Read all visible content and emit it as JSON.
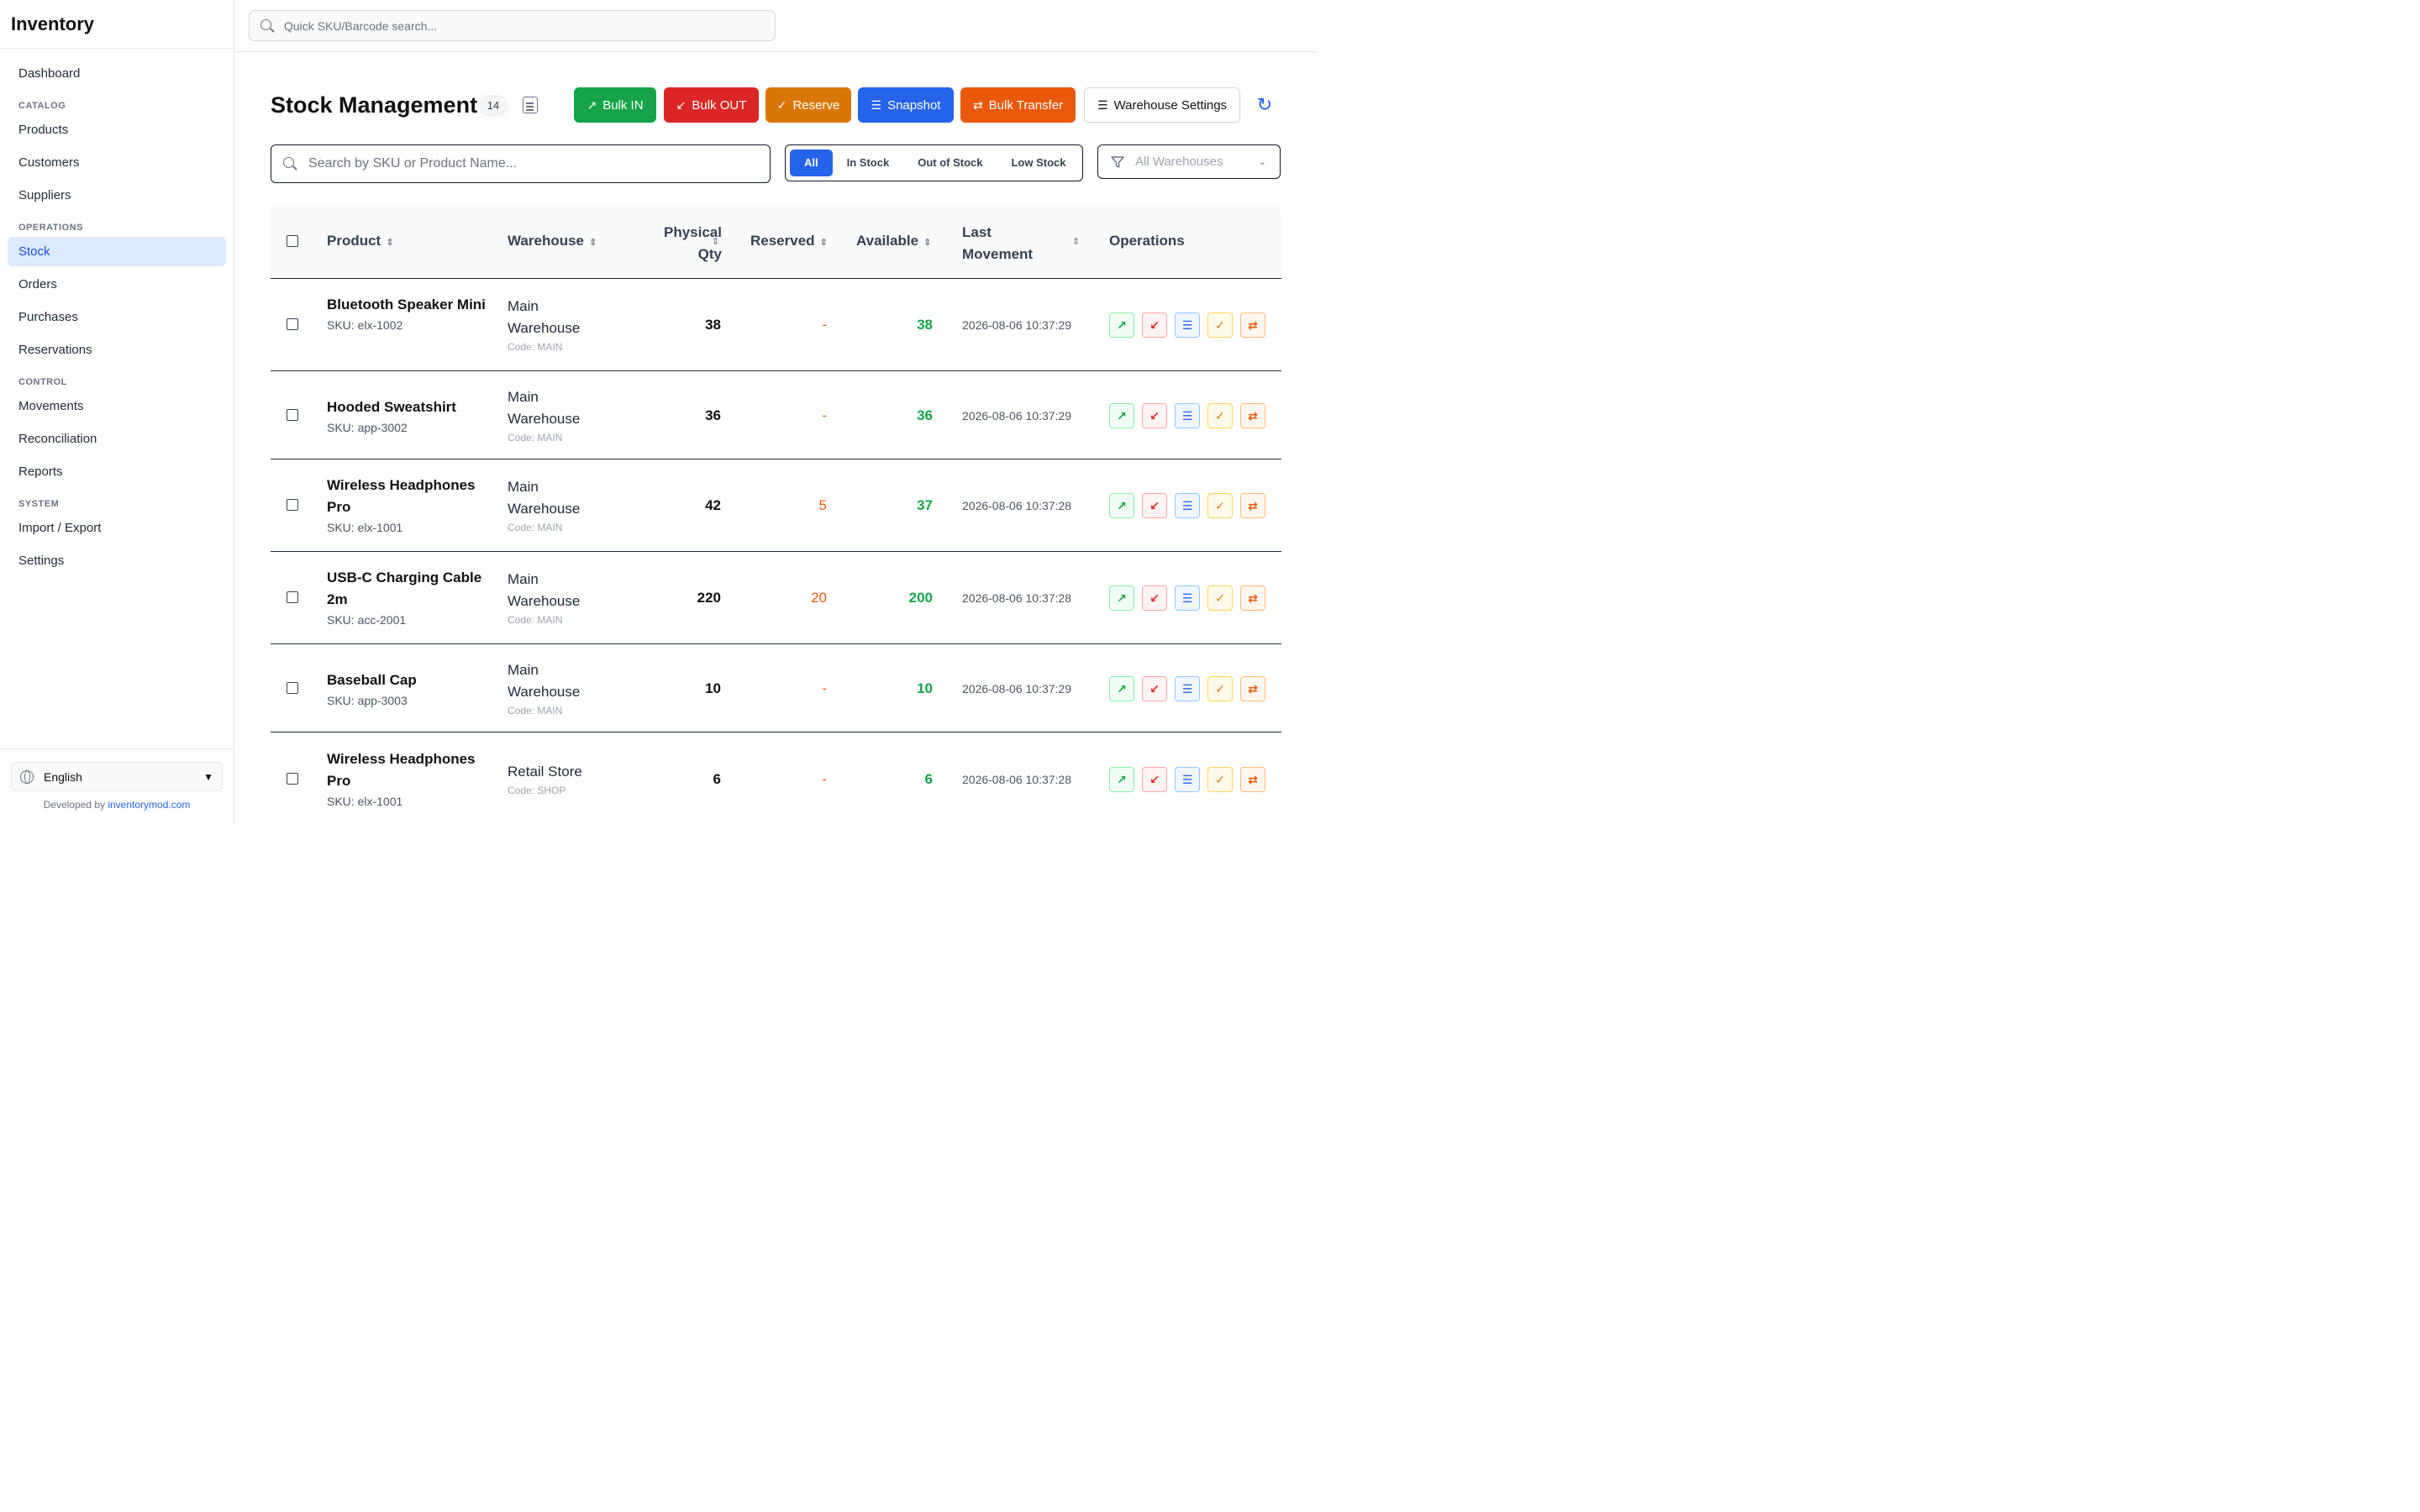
{
  "sidebar": {
    "brand": "Inventory",
    "items_top": [
      {
        "label": "Dashboard"
      }
    ],
    "catalog": {
      "title": "CATALOG",
      "items": [
        {
          "label": "Products"
        },
        {
          "label": "Customers"
        },
        {
          "label": "Suppliers"
        }
      ]
    },
    "operations": {
      "title": "OPERATIONS",
      "items": [
        {
          "label": "Stock",
          "active": true
        },
        {
          "label": "Orders"
        },
        {
          "label": "Purchases"
        },
        {
          "label": "Reservations"
        }
      ]
    },
    "control": {
      "title": "CONTROL",
      "items": [
        {
          "label": "Movements"
        },
        {
          "label": "Reconciliation"
        },
        {
          "label": "Reports"
        }
      ]
    },
    "system": {
      "title": "SYSTEM",
      "items": [
        {
          "label": "Import / Export"
        },
        {
          "label": "Settings"
        }
      ]
    },
    "language": "English",
    "dev_prefix": "Developed by",
    "dev_link": "inventorymod.com"
  },
  "topbar": {
    "quick_search_placeholder": "Quick SKU/Barcode search..."
  },
  "header": {
    "title": "Stock Management",
    "count": "14",
    "buttons": {
      "bulk_in": "Bulk IN",
      "bulk_out": "Bulk OUT",
      "reserve": "Reserve",
      "snapshot": "Snapshot",
      "bulk_transfer": "Bulk Transfer",
      "warehouse_settings": "Warehouse Settings"
    }
  },
  "filters": {
    "search_placeholder": "Search by SKU or Product Name...",
    "status_tabs": [
      "All",
      "In Stock",
      "Out of Stock",
      "Low Stock"
    ],
    "active_tab": "All",
    "warehouse_placeholder": "All Warehouses"
  },
  "table": {
    "columns": {
      "product": "Product",
      "warehouse": "Warehouse",
      "physical_qty_1": "Physical",
      "physical_qty_2": "Qty",
      "reserved": "Reserved",
      "available": "Available",
      "last_movement_1": "Last",
      "last_movement_2": "Movement",
      "operations": "Operations"
    },
    "rows": [
      {
        "name": "Bluetooth Speaker Mini",
        "sku": "SKU: elx-1002",
        "warehouse": "Main Warehouse",
        "code": "Code: MAIN",
        "qty": "38",
        "reserved": "-",
        "available": "38",
        "last": "2026-08-06 10:37:29"
      },
      {
        "name": "Hooded Sweatshirt",
        "sku": "SKU: app-3002",
        "warehouse": "Main Warehouse",
        "code": "Code: MAIN",
        "qty": "36",
        "reserved": "-",
        "available": "36",
        "last": "2026-08-06 10:37:29"
      },
      {
        "name": "Wireless Headphones Pro",
        "sku": "SKU: elx-1001",
        "warehouse": "Main Warehouse",
        "code": "Code: MAIN",
        "qty": "42",
        "reserved": "5",
        "available": "37",
        "last": "2026-08-06 10:37:28"
      },
      {
        "name": "USB-C Charging Cable 2m",
        "sku": "SKU: acc-2001",
        "warehouse": "Main Warehouse",
        "code": "Code: MAIN",
        "qty": "220",
        "reserved": "20",
        "available": "200",
        "last": "2026-08-06 10:37:28"
      },
      {
        "name": "Baseball Cap",
        "sku": "SKU: app-3003",
        "warehouse": "Main Warehouse",
        "code": "Code: MAIN",
        "qty": "10",
        "reserved": "-",
        "available": "10",
        "last": "2026-08-06 10:37:29"
      },
      {
        "name": "Wireless Headphones Pro",
        "sku": "SKU: elx-1001",
        "warehouse": "Retail Store",
        "code": "Code: SHOP",
        "qty": "6",
        "reserved": "-",
        "available": "6",
        "last": "2026-08-06 10:37:28"
      }
    ]
  },
  "colors": {
    "accent": "#2563eb",
    "in": "#16a34a",
    "out": "#dc2626",
    "reserve": "#d97706",
    "transfer": "#ea580c"
  }
}
